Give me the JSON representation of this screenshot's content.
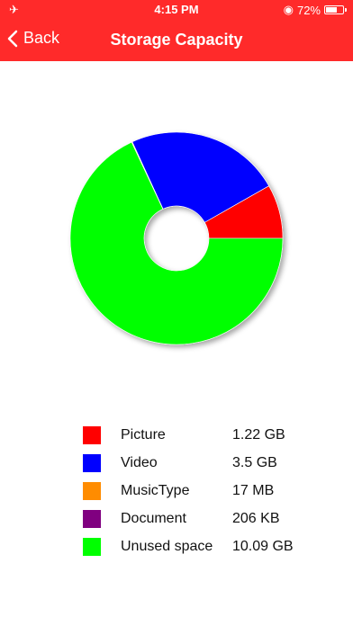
{
  "status_bar": {
    "time": "4:15 PM",
    "battery_text": "72%",
    "battery_level": 0.72
  },
  "nav": {
    "back_label": "Back",
    "title": "Storage Capacity"
  },
  "colors": {
    "header": "#ff2a2a"
  },
  "chart_data": {
    "type": "pie",
    "variant": "donut",
    "categories": [
      "Picture",
      "Video",
      "MusicType",
      "Document",
      "Unused space"
    ],
    "values": [
      1.22,
      3.5,
      0.017,
      0.000206,
      10.09
    ],
    "units": "GB",
    "colors": [
      "#ff0000",
      "#0000ff",
      "#ff8c00",
      "#800080",
      "#00ff00"
    ],
    "title": ""
  },
  "legend": {
    "items": [
      {
        "label": "Picture",
        "value": "1.22 GB",
        "color": "#ff0000"
      },
      {
        "label": "Video",
        "value": "3.5 GB",
        "color": "#0000ff"
      },
      {
        "label": "MusicType",
        "value": "17 MB",
        "color": "#ff8c00"
      },
      {
        "label": "Document",
        "value": "206 KB",
        "color": "#800080"
      },
      {
        "label": "Unused space",
        "value": "10.09 GB",
        "color": "#00ff00"
      }
    ]
  }
}
